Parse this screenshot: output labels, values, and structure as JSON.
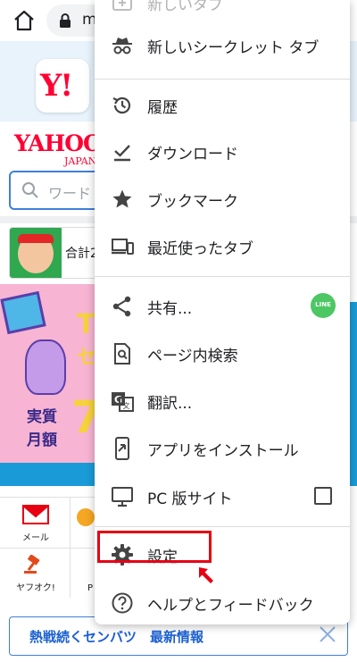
{
  "browser": {
    "url_partial": "m",
    "home_icon": "home-icon",
    "lock_icon": "lock-icon"
  },
  "page": {
    "app_icon_text": "Y!",
    "logo": "YAHOO!",
    "logo_sub": "JAPAN",
    "search_placeholder": "ワード",
    "promo_text": "合計2",
    "banner": {
      "line1": "T",
      "line2": "セ",
      "line3": "実質",
      "line4": "月額",
      "line5": "7"
    },
    "services": {
      "mail_label": "メール",
      "auction_label": "ヤフオク!",
      "p_label": "P"
    },
    "notice": {
      "text": "熱戦続くセンバツ　最新情報",
      "close_icon": "close-icon"
    }
  },
  "menu": {
    "items": [
      {
        "id": "new-tab",
        "label": "新しいタブ",
        "icon": "new-tab-icon",
        "faded": true
      },
      {
        "id": "incognito",
        "label": "新しいシークレット タブ",
        "icon": "incognito-icon"
      },
      {
        "id": "history",
        "label": "履歴",
        "icon": "history-icon"
      },
      {
        "id": "downloads",
        "label": "ダウンロード",
        "icon": "download-check-icon"
      },
      {
        "id": "bookmarks",
        "label": "ブックマーク",
        "icon": "star-icon"
      },
      {
        "id": "recent-tabs",
        "label": "最近使ったタブ",
        "icon": "devices-icon"
      },
      {
        "id": "share",
        "label": "共有...",
        "icon": "share-icon",
        "badge": "LINE"
      },
      {
        "id": "find-in-page",
        "label": "ページ内検索",
        "icon": "find-in-page-icon"
      },
      {
        "id": "translate",
        "label": "翻訳...",
        "icon": "translate-icon"
      },
      {
        "id": "install-app",
        "label": "アプリをインストール",
        "icon": "install-app-icon"
      },
      {
        "id": "desktop-site",
        "label": "PC 版サイト",
        "icon": "desktop-icon",
        "checked": false
      },
      {
        "id": "settings",
        "label": "設定",
        "icon": "gear-icon",
        "highlighted": true
      },
      {
        "id": "help",
        "label": "ヘルプとフィードバック",
        "icon": "help-icon"
      }
    ]
  },
  "colors": {
    "highlight_red": "#e60012",
    "yahoo_red": "#ff0033",
    "line_green": "#4cc764",
    "menu_text": "#202124"
  }
}
